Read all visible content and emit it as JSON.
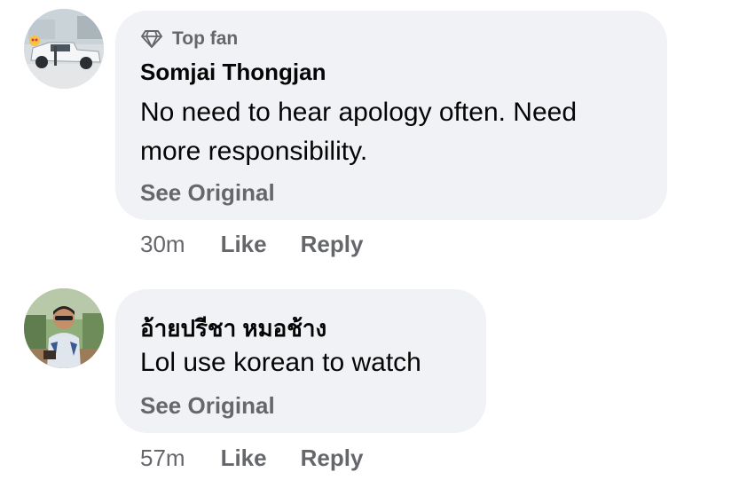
{
  "comments": [
    {
      "badge": "Top fan",
      "badge_icon": "diamond-icon",
      "author": "Somjai Thongjan",
      "text_lines": [
        "No need to hear apology often. Need",
        "more responsibility."
      ],
      "see_original": "See Original",
      "time": "30m",
      "like": "Like",
      "reply": "Reply"
    },
    {
      "author": "อ้ายปรีชา หมอช้าง",
      "text_lines": [
        "Lol use korean to watch"
      ],
      "see_original": "See Original",
      "time": "57m",
      "like": "Like",
      "reply": "Reply"
    }
  ],
  "colors": {
    "bubble": "#f0f2f5",
    "secondary_text": "#65676b",
    "primary_text": "#050505"
  }
}
